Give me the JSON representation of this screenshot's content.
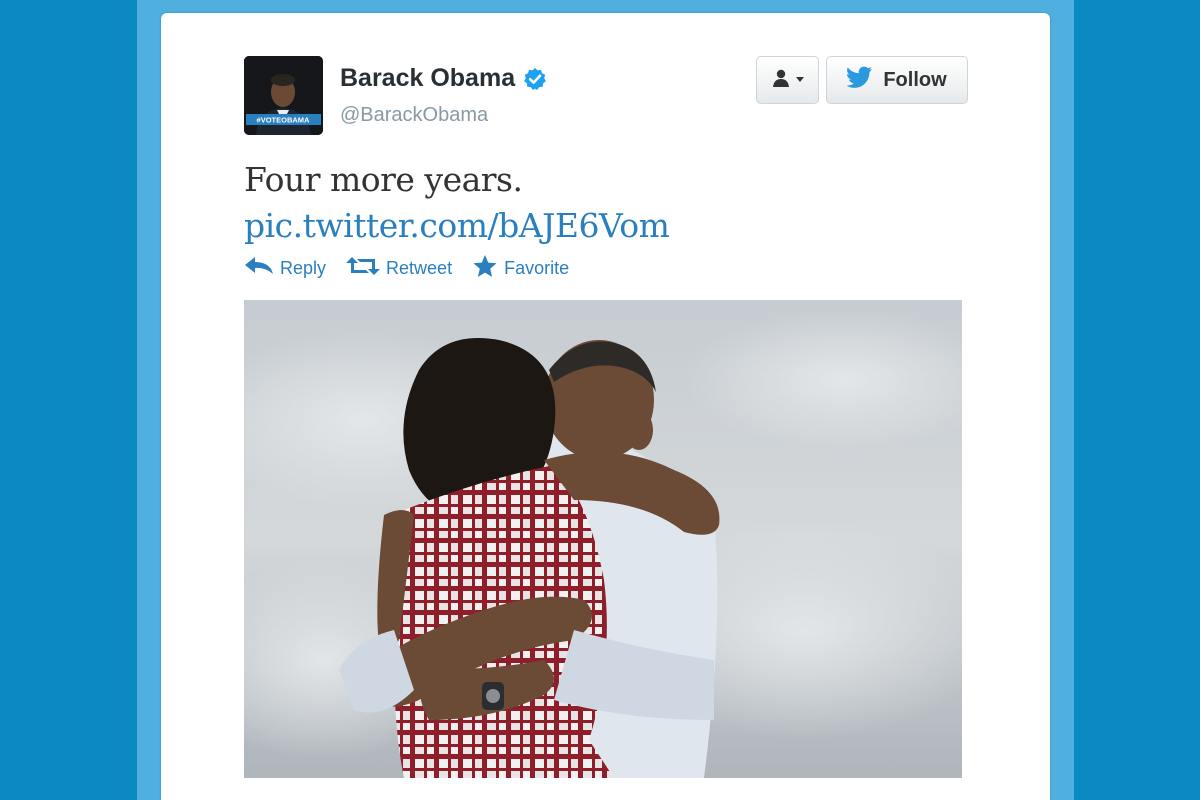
{
  "tweet": {
    "display_name": "Barack Obama",
    "handle": "@BarackObama",
    "text": "Four more years.",
    "link": "pic.twitter.com/bAJE6Vom",
    "avatar_badge": "#VOTEOBAMA"
  },
  "buttons": {
    "follow_label": "Follow"
  },
  "actions": {
    "reply_label": "Reply",
    "retweet_label": "Retweet",
    "favorite_label": "Favorite"
  },
  "colors": {
    "background": "#0b8ac2",
    "frame": "#4fb0e0",
    "link": "#2a7fbf",
    "verified": "#1da1f2",
    "twitter_bird": "#2a9ae0"
  },
  "icons": {
    "verified": "verified-icon",
    "user": "user-icon",
    "dropdown": "caret-down-icon",
    "twitter": "twitter-bird-icon",
    "reply": "reply-icon",
    "retweet": "retweet-icon",
    "favorite": "star-icon"
  }
}
